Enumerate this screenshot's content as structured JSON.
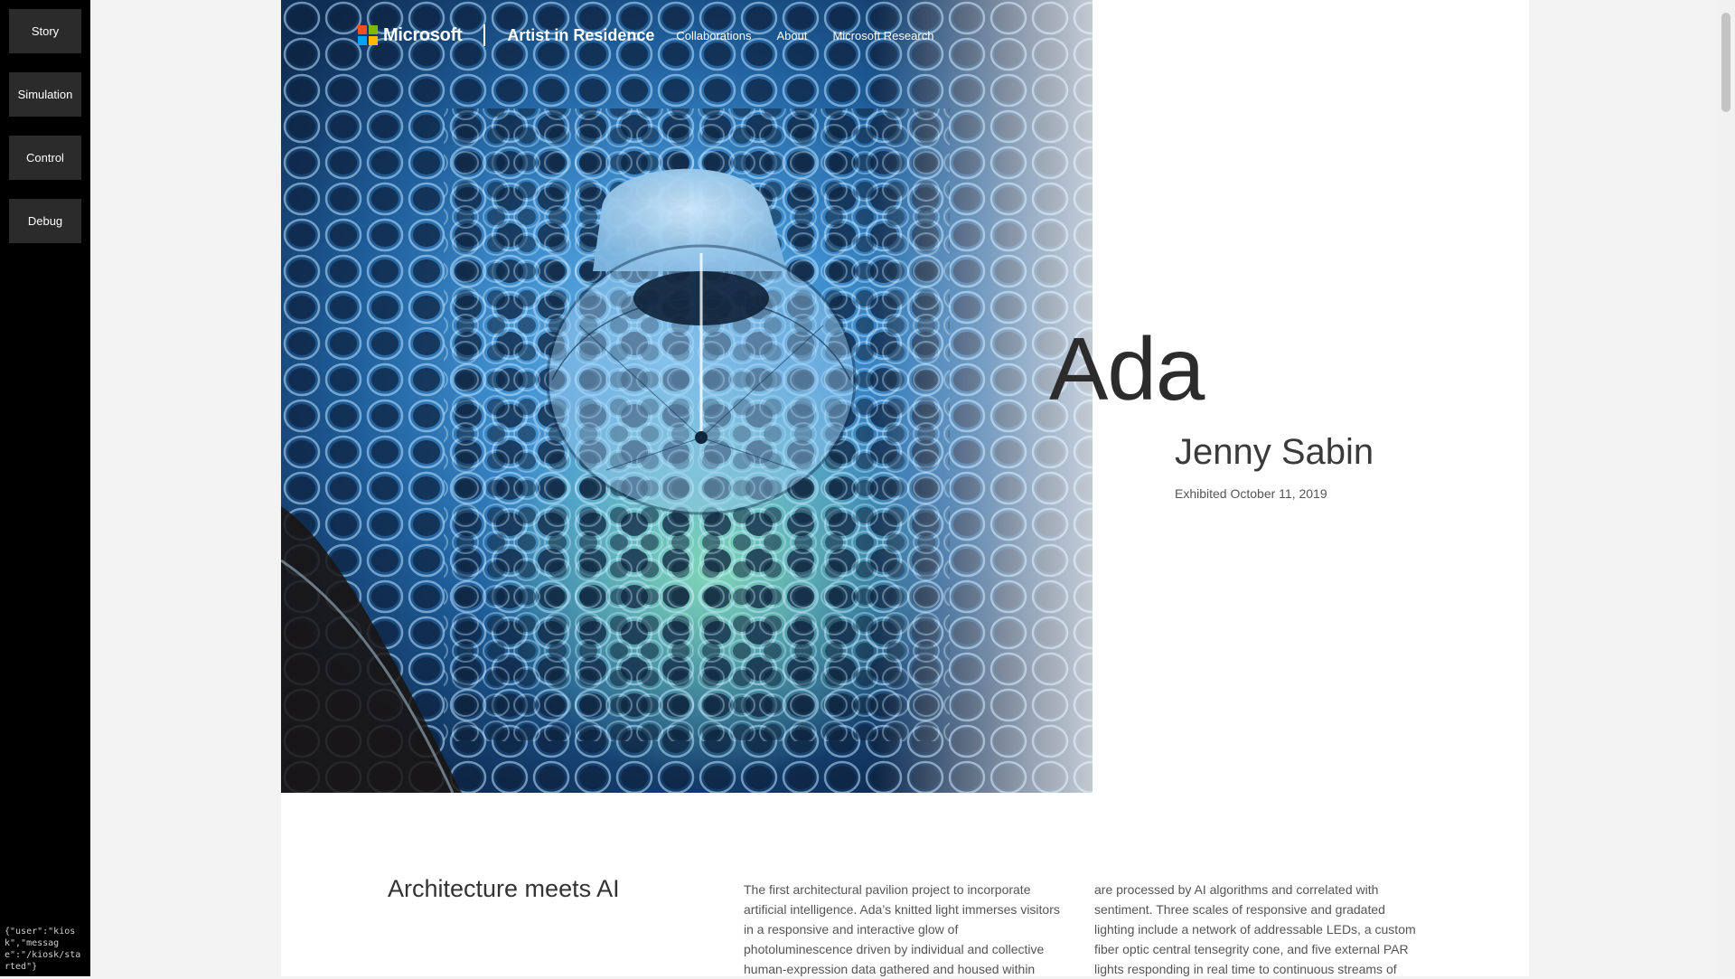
{
  "sidebar": {
    "buttons": [
      {
        "label": "Story"
      },
      {
        "label": "Simulation"
      },
      {
        "label": "Control"
      },
      {
        "label": "Debug"
      }
    ],
    "status_text": "{\"user\":\"kiosk\",\"message\":\"/kiosk/started\"}"
  },
  "nav": {
    "brand": "Microsoft",
    "site_title": "Artist in Residence",
    "links": [
      {
        "label": "Collaborations"
      },
      {
        "label": "About"
      },
      {
        "label": "Microsoft Research"
      }
    ],
    "logo_colors": [
      "#f25022",
      "#7fba00",
      "#00a4ef",
      "#ffb900"
    ]
  },
  "hero": {
    "title": "Ada",
    "artist": "Jenny Sabin",
    "exhibited": "Exhibited October 11, 2019"
  },
  "article": {
    "heading": "Architecture meets AI",
    "col1": "The first architectural pavilion project to incorporate artificial intelligence. Ada’s knitted light immerses visitors in a responsive and interactive glow of photoluminescence driven by individual and collective human-expression data gathered and housed within",
    "col2": "are processed by AI algorithms and correlated with sentiment. Three scales of responsive and gradated lighting include a network of addressable LEDs, a custom fiber optic central tensegrity cone, and five external PAR lights responding in real time to continuous streams of"
  }
}
